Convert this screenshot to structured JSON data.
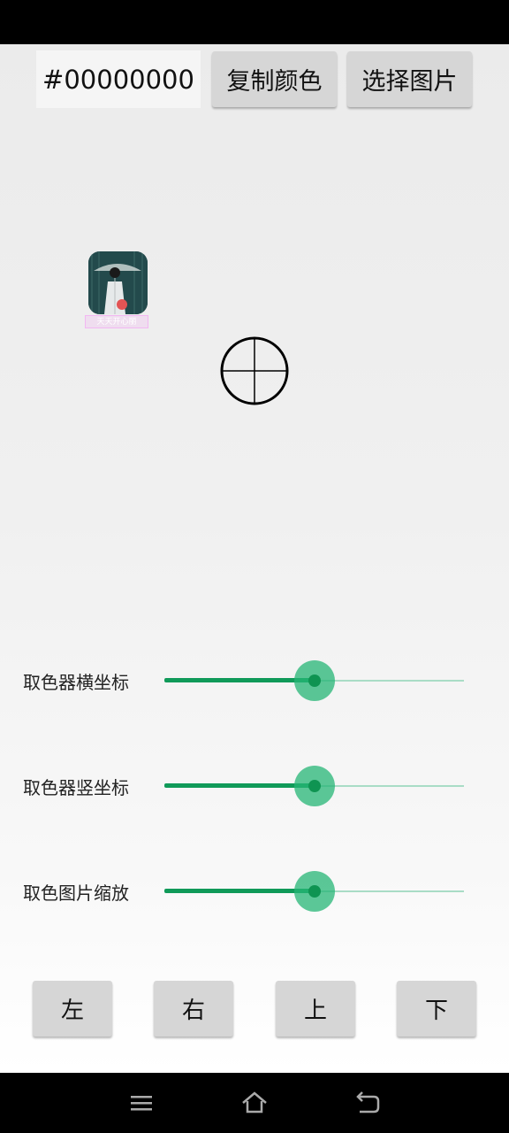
{
  "toolbar": {
    "color_value": "#00000000",
    "copy_color_label": "复制颜色",
    "select_image_label": "选择图片"
  },
  "preview": {
    "thumbnail_caption": "天天开心丽"
  },
  "sliders": [
    {
      "label": "取色器横坐标",
      "value_fraction": 0.5
    },
    {
      "label": "取色器竖坐标",
      "value_fraction": 0.5
    },
    {
      "label": "取色图片缩放",
      "value_fraction": 0.5
    }
  ],
  "direction_buttons": {
    "left": "左",
    "right": "右",
    "up": "上",
    "down": "下"
  },
  "nav_bar": {
    "icons": [
      "menu-icon",
      "home-icon",
      "back-icon"
    ]
  },
  "colors": {
    "accent": "#109a59",
    "button_bg": "#d6d6d6"
  }
}
